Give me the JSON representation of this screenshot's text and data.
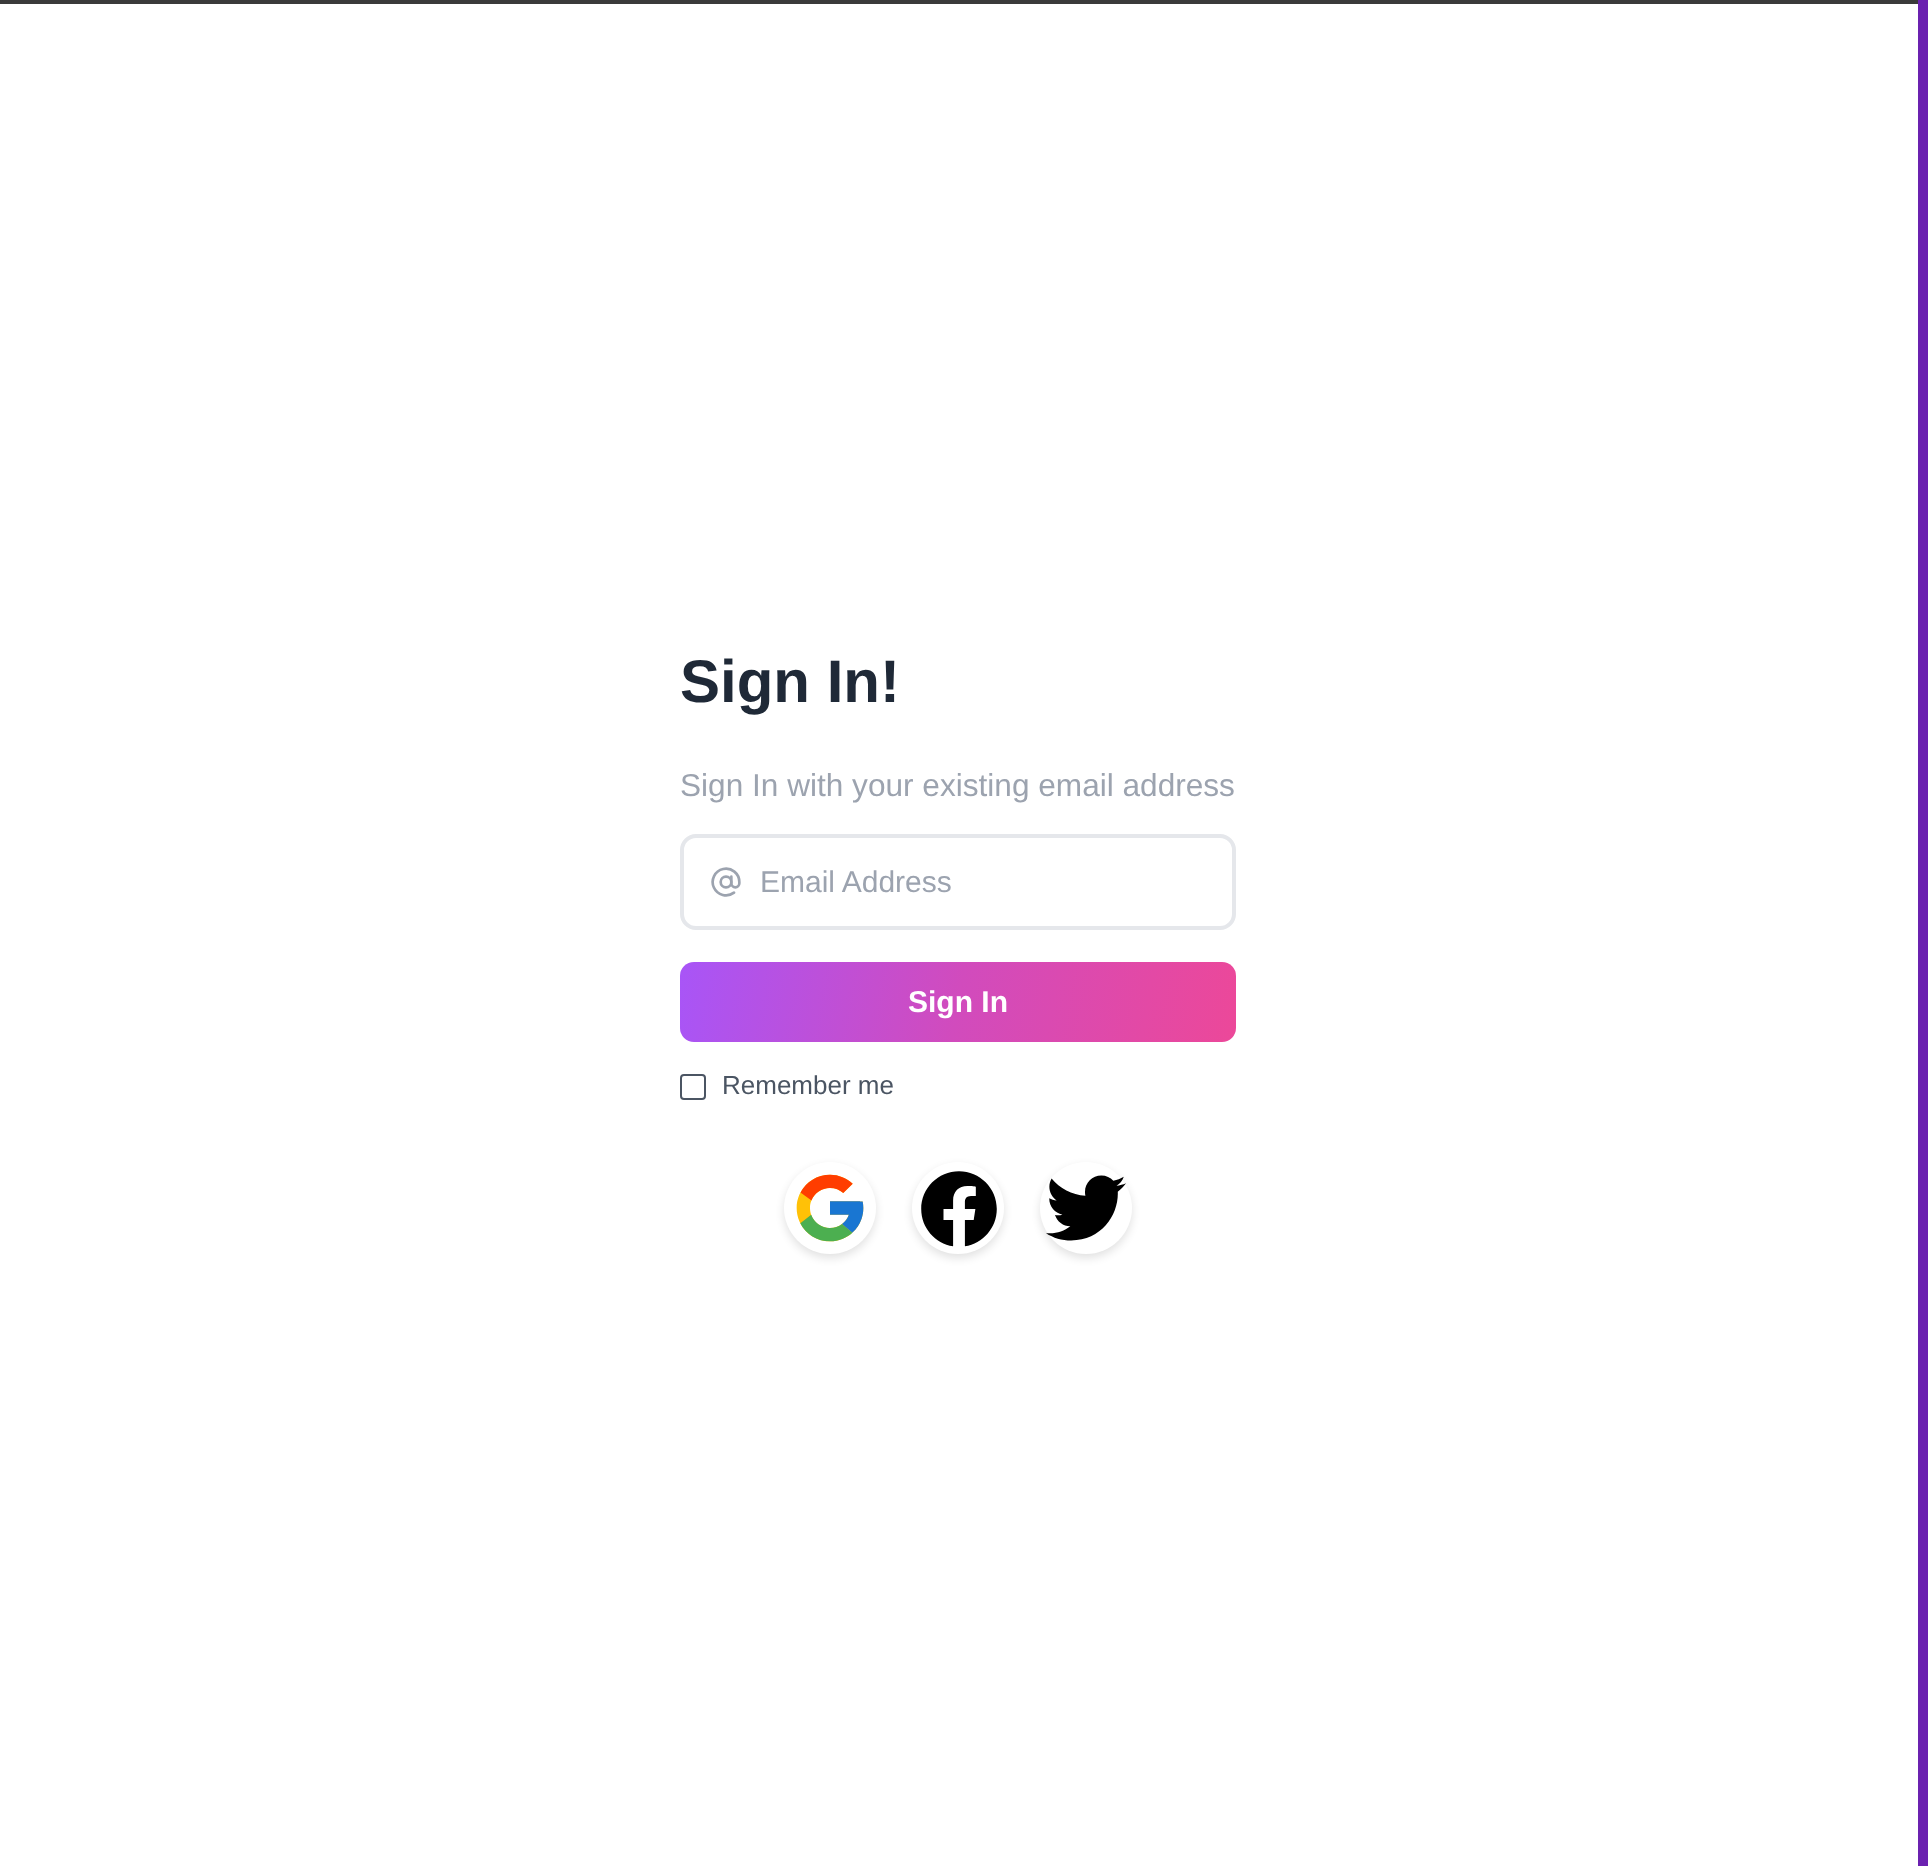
{
  "title": "Sign In!",
  "subtitle": "Sign In with your existing email address",
  "email_field": {
    "placeholder": "Email Address"
  },
  "sign_in_button": {
    "label": "Sign In"
  },
  "remember_me": {
    "label": "Remember me",
    "checked": false
  },
  "social_logins": [
    {
      "kind": "google"
    },
    {
      "kind": "facebook"
    },
    {
      "kind": "twitter"
    }
  ]
}
